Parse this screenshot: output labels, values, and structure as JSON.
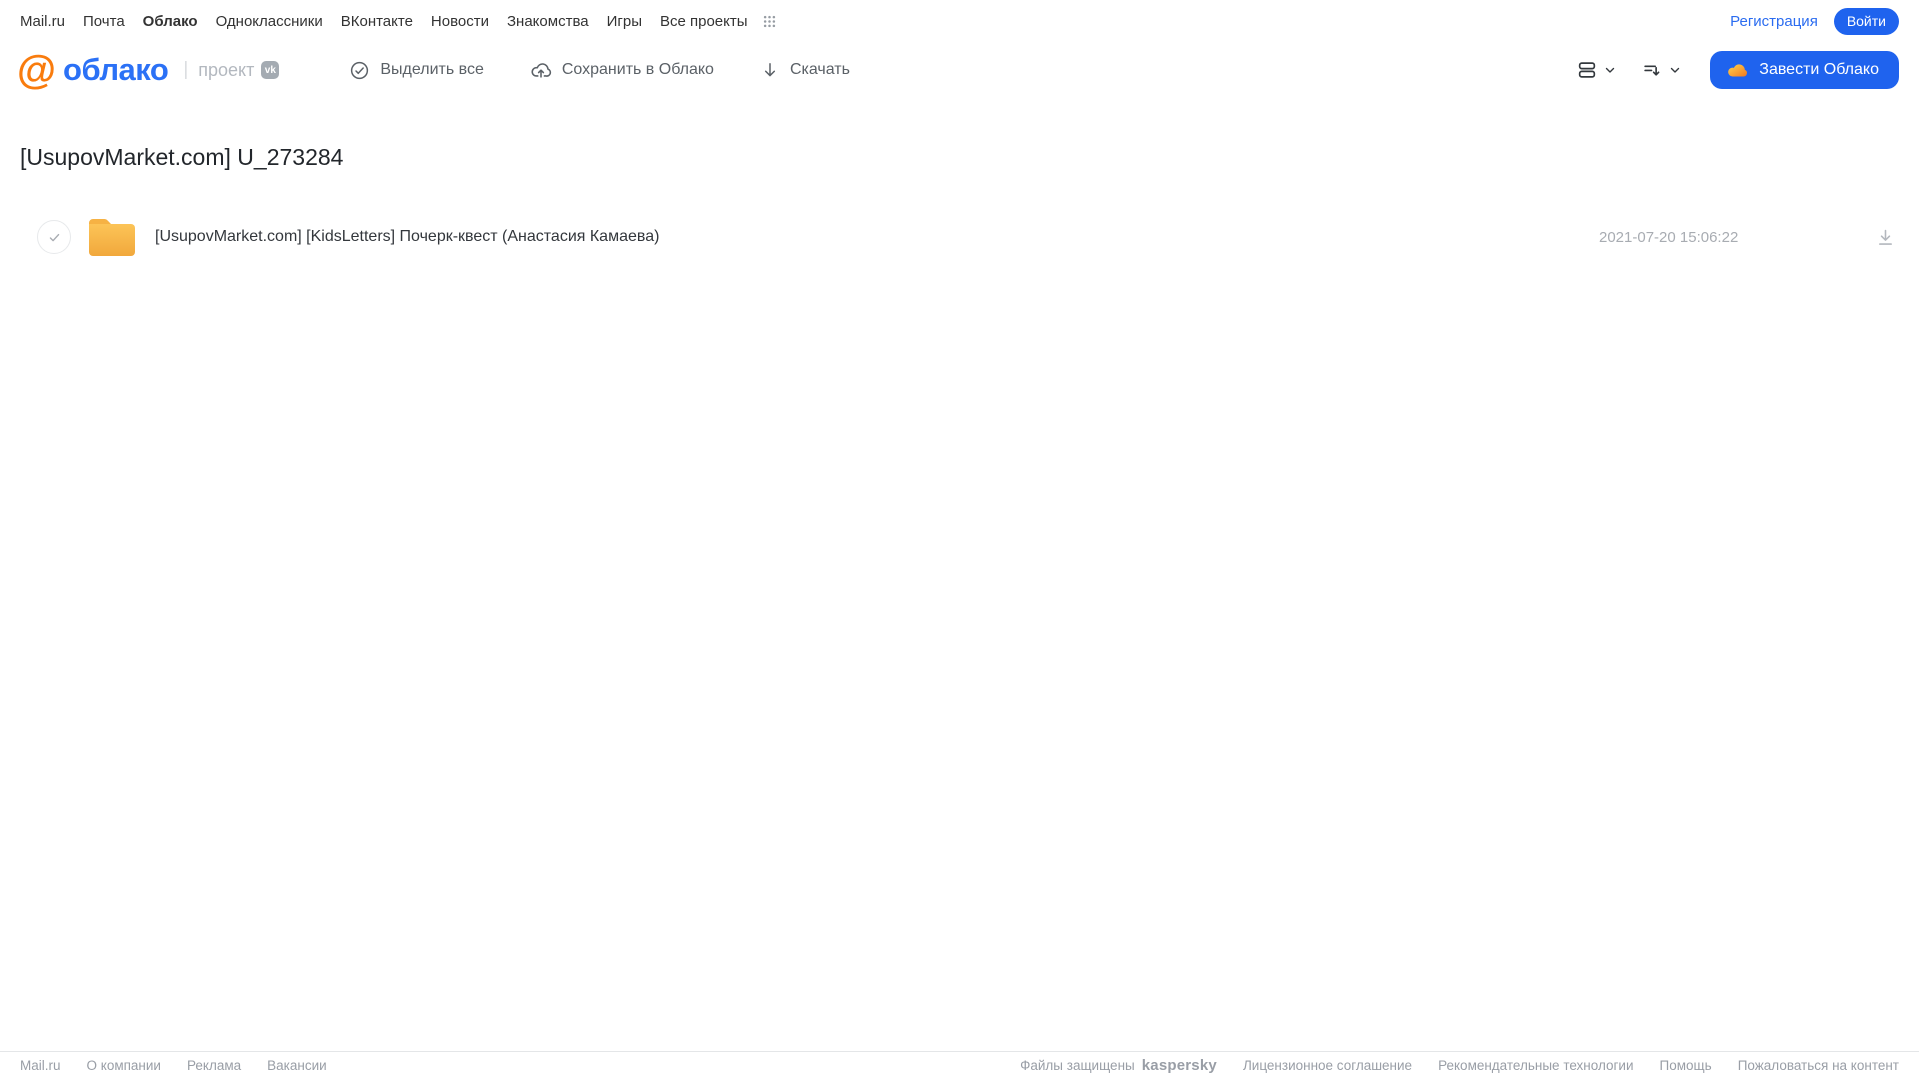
{
  "topnav": {
    "links": [
      {
        "label": "Mail.ru"
      },
      {
        "label": "Почта"
      },
      {
        "label": "Облако"
      },
      {
        "label": "Одноклассники"
      },
      {
        "label": "ВКонтакте"
      },
      {
        "label": "Новости"
      },
      {
        "label": "Знакомства"
      },
      {
        "label": "Игры"
      },
      {
        "label": "Все проекты"
      }
    ],
    "registration_label": "Регистрация",
    "login_label": "Войти"
  },
  "header": {
    "logo_brand": "облако",
    "logo_pipe": "|",
    "logo_project": "проект",
    "vk_badge": "vk",
    "actions": [
      {
        "label": "Выделить все",
        "icon": "check-circle-icon"
      },
      {
        "label": "Сохранить в Облако",
        "icon": "cloud-upload-icon"
      },
      {
        "label": "Скачать",
        "icon": "download-icon"
      }
    ],
    "view_controls": [
      {
        "icon": "view-list-icon"
      },
      {
        "icon": "sort-icon"
      }
    ],
    "get_cloud_label": "Завести Облако"
  },
  "page": {
    "title": "[UsupovMarket.com] U_273284"
  },
  "files": [
    {
      "type": "folder",
      "name": "[UsupovMarket.com] [KidsLetters] Почерк-квест (Анастасия Камаева)",
      "modified": "2021-07-20 15:06:22"
    }
  ],
  "footer": {
    "left_links": [
      "Mail.ru",
      "О компании",
      "Реклама",
      "Вакансии"
    ],
    "protected_by": "Файлы защищены",
    "kaspersky_label": "kaspersky",
    "right_links": [
      "Лицензионное соглашение",
      "Рекомендательные технологии",
      "Помощь",
      "Пожаловаться на контент"
    ]
  },
  "colors": {
    "accent_blue": "#1f63ee",
    "link_blue": "#2b6cf0",
    "brand_orange": "#f97c0e",
    "folder_yellow": "#f5ab3d",
    "kaspersky_green": "#00836f"
  }
}
